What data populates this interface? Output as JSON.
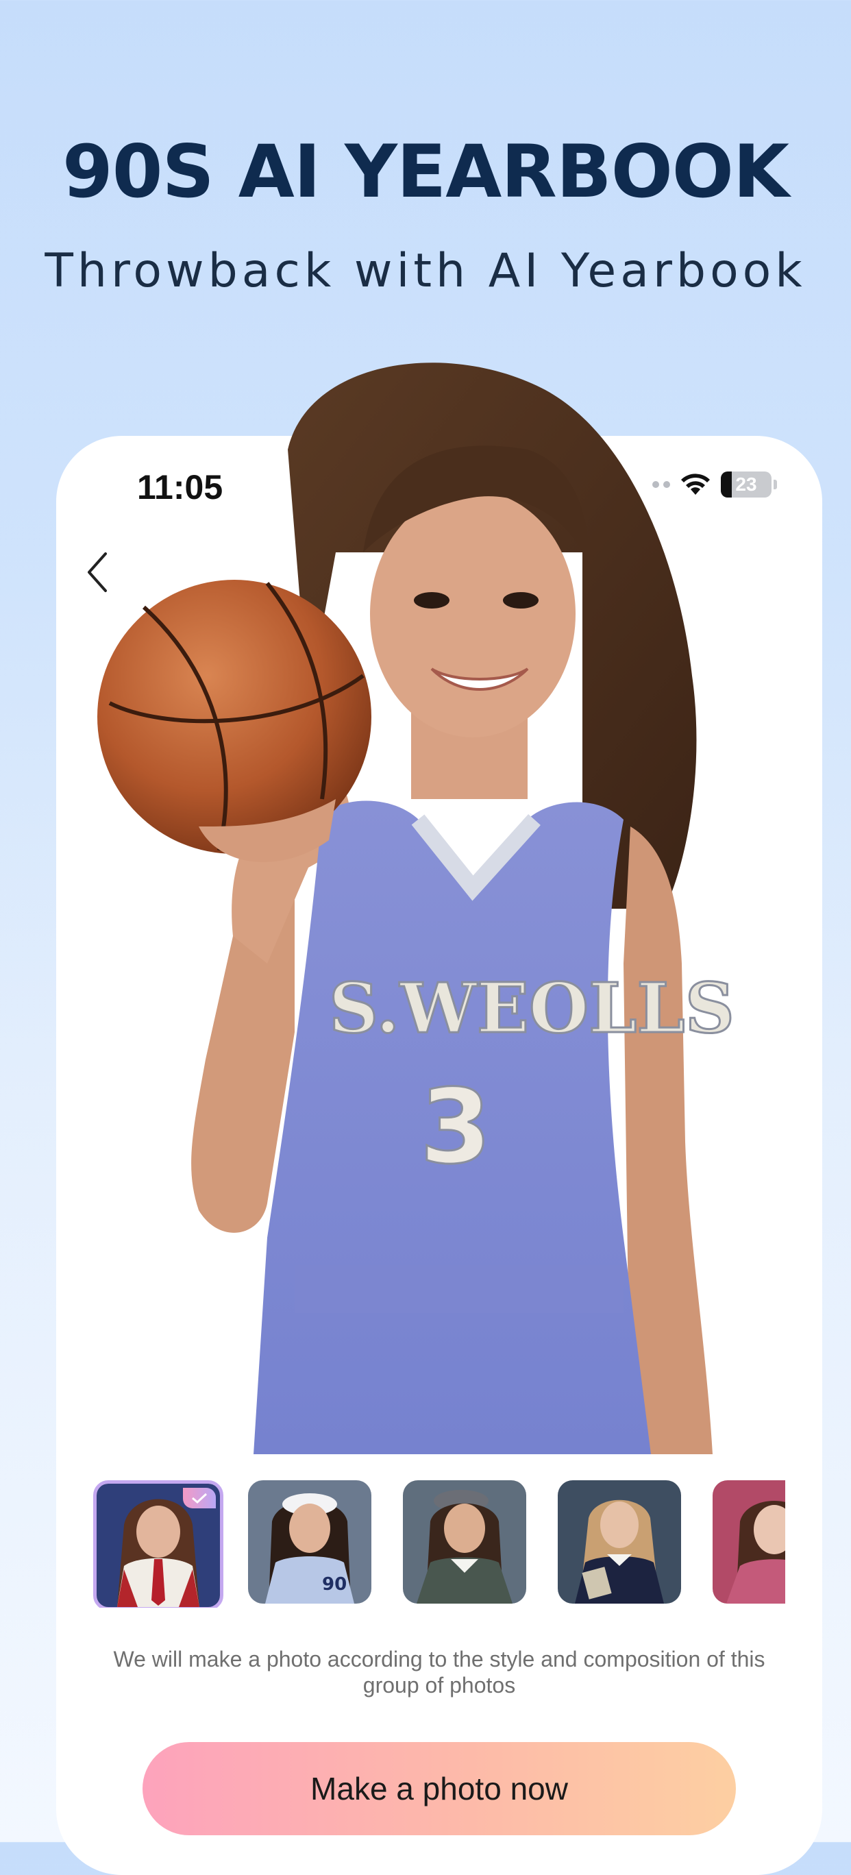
{
  "hero": {
    "title": "90S AI YEARBOOK",
    "subtitle": "Throwback with AI Yearbook"
  },
  "status_bar": {
    "time": "11:05",
    "battery": "23"
  },
  "photo": {
    "jersey_text": "S.WEOLLS",
    "jersey_number": "3"
  },
  "thumbnails": [
    {
      "name": "style-schoolgirl-red-tie",
      "selected": true
    },
    {
      "name": "style-baseball-jersey",
      "selected": false,
      "number": "90"
    },
    {
      "name": "style-plaid-hat",
      "selected": false
    },
    {
      "name": "style-navy-sweater",
      "selected": false
    },
    {
      "name": "style-pink-velvet",
      "selected": false
    }
  ],
  "hint": "We will make a photo according to the style and composition of this group of photos",
  "cta": {
    "label": "Make a photo now"
  },
  "colors": {
    "title": "#0f2b4f",
    "cta_start": "#fda3bc",
    "cta_end": "#fdcfa2",
    "background": "#c6ddfb"
  }
}
